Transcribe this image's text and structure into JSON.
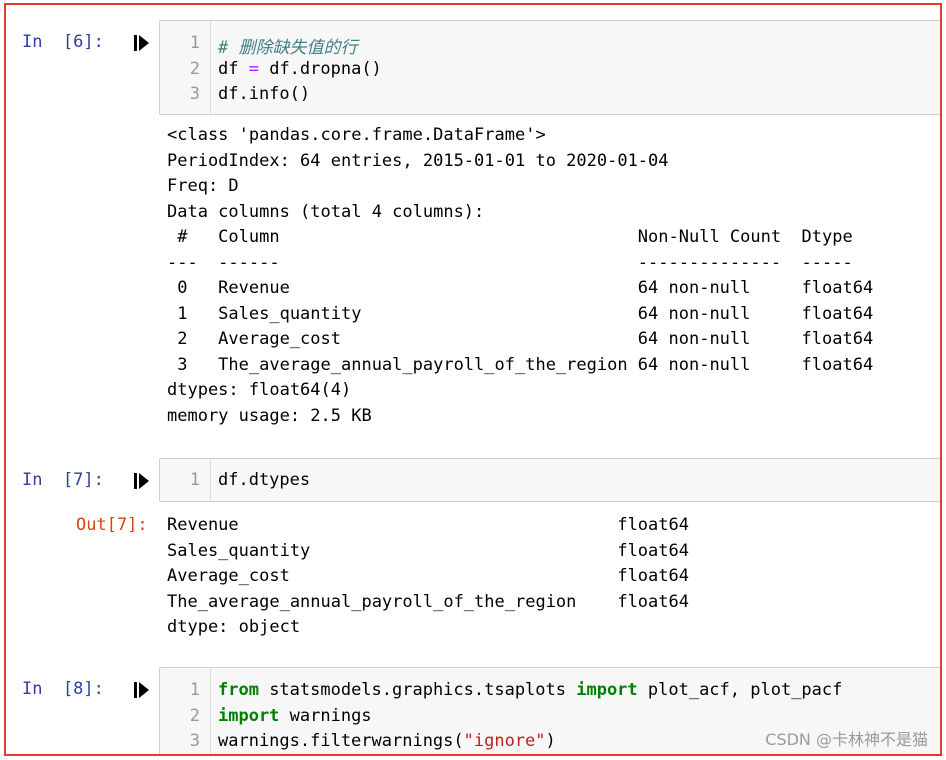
{
  "cells": [
    {
      "prompt": "In  [6]:",
      "lines": {
        "n1": "1",
        "n2": "2",
        "n3": "3",
        "c1": "# 删除缺失值的行",
        "c2_a": "df ",
        "c2_op": "=",
        "c2_b": " df.dropna()",
        "c3": "df.info()"
      },
      "output": [
        "<class 'pandas.core.frame.DataFrame'>",
        "PeriodIndex: 64 entries, 2015-01-01 to 2020-01-04",
        "Freq: D",
        "Data columns (total 4 columns):",
        " #   Column                                   Non-Null Count  Dtype  ",
        "---  ------                                   --------------  -----  ",
        " 0   Revenue                                  64 non-null     float64",
        " 1   Sales_quantity                           64 non-null     float64",
        " 2   Average_cost                             64 non-null     float64",
        " 3   The_average_annual_payroll_of_the_region 64 non-null     float64",
        "dtypes: float64(4)",
        "memory usage: 2.5 KB"
      ]
    },
    {
      "prompt": "In  [7]:",
      "lines": {
        "n1": "1",
        "c1": "df.dtypes"
      },
      "out_prompt": "Out[7]:",
      "output": [
        "Revenue                                     float64",
        "Sales_quantity                              float64",
        "Average_cost                                float64",
        "The_average_annual_payroll_of_the_region    float64",
        "dtype: object"
      ]
    },
    {
      "prompt": "In  [8]:",
      "lines": {
        "n1": "1",
        "n2": "2",
        "n3": "3",
        "c1_kw1": "from",
        "c1_mid": " statsmodels.graphics.tsaplots ",
        "c1_kw2": "import",
        "c1_end": " plot_acf, plot_pacf",
        "c2_kw": "import",
        "c2_end": " warnings",
        "c3_a": "warnings.filterwarnings(",
        "c3_str": "\"ignore\"",
        "c3_b": ")"
      }
    }
  ],
  "watermark": "CSDN @卡林神不是猫",
  "colors": {
    "frame_border": "#e53935",
    "in_prompt": "#303f9f",
    "out_prompt": "#d84315",
    "keyword": "#008000",
    "comment": "#408080",
    "string": "#ba2121"
  }
}
